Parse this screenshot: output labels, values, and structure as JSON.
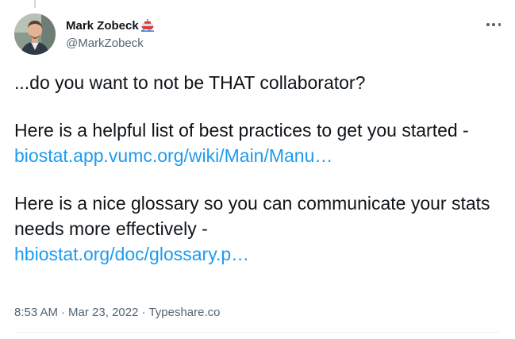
{
  "author": {
    "name": "Mark Zobeck",
    "name_emoji_icon": "ship-icon",
    "handle": "@MarkZobeck",
    "avatar_icon": "profile-photo"
  },
  "more_icon": "more-horizontal-icon",
  "tweet": {
    "line1": "...do you want to not be THAT collaborator?",
    "para2_text": "Here is a helpful list of best practices to get you started -",
    "para2_link": "biostat.app.vumc.org/wiki/Main/Manu…",
    "para3_text": "Here is a nice glossary so you can communicate your stats needs more effectively -",
    "para3_link": "hbiostat.org/doc/glossary.p…"
  },
  "meta": {
    "time": "8:53 AM",
    "date": "Mar 23, 2022",
    "source": "Typeshare.co",
    "separator": "·"
  },
  "colors": {
    "link": "#1d9bf0",
    "text": "#0f1419",
    "muted": "#536471"
  }
}
